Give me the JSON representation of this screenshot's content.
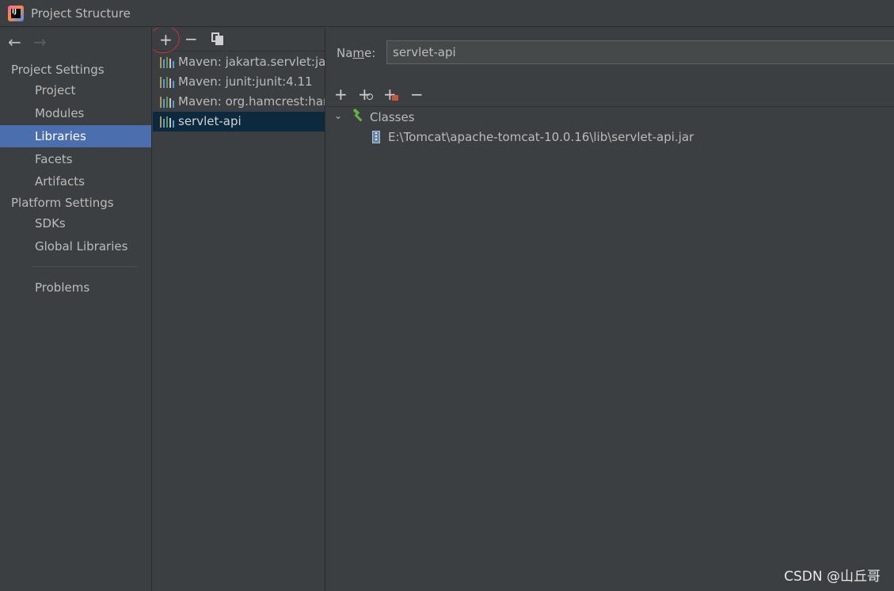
{
  "window": {
    "title": "Project Structure"
  },
  "nav": {
    "back_icon": "arrow-left-icon",
    "forward_icon": "arrow-right-icon"
  },
  "sidebar": {
    "project_settings_header": "Project Settings",
    "project_items": [
      {
        "label": "Project"
      },
      {
        "label": "Modules"
      },
      {
        "label": "Libraries",
        "selected": true
      },
      {
        "label": "Facets"
      },
      {
        "label": "Artifacts"
      }
    ],
    "platform_settings_header": "Platform Settings",
    "platform_items": [
      {
        "label": "SDKs"
      },
      {
        "label": "Global Libraries"
      }
    ],
    "problems_label": "Problems"
  },
  "libraries": {
    "toolbar": {
      "add_icon": "+",
      "remove_icon": "−"
    },
    "items": [
      {
        "label": "Maven: jakarta.servlet:jakarta.servlet-api"
      },
      {
        "label": "Maven: junit:junit:4.11"
      },
      {
        "label": "Maven: org.hamcrest:hamcrest-core"
      },
      {
        "label": "servlet-api",
        "selected": true
      }
    ],
    "annotation_color": "#c73035"
  },
  "detail": {
    "name_label_prefix": "Na",
    "name_label_underlined": "m",
    "name_label_suffix": "e:",
    "name_value": "servlet-api",
    "toolbar": {
      "add": "+",
      "add_sub": "+",
      "add_other": "+",
      "remove": "−"
    },
    "tree": {
      "root_label": "Classes",
      "jar_path": "E:\\Tomcat\\apache-tomcat-10.0.16\\lib\\servlet-api.jar"
    }
  },
  "watermark": "CSDN @山丘哥",
  "colors": {
    "background": "#3c3f41",
    "selection_blue": "#4b6eaf",
    "list_selection": "#0d293e",
    "annotation_red": "#c73035"
  }
}
